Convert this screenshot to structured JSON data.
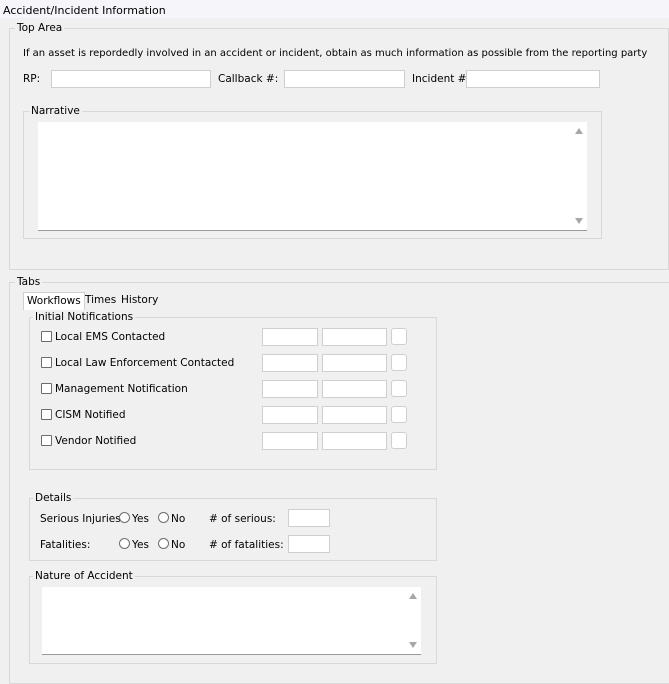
{
  "window": {
    "title": "Accident/Incident Information"
  },
  "top_area": {
    "legend": "Top Area",
    "instructions": "If an asset is repordedly involved in an accident or incident, obtain as much information as possible from the reporting party",
    "rp_label": "RP:",
    "rp_value": "",
    "callback_label": "Callback #:",
    "callback_value": "",
    "incident_label": "Incident #",
    "incident_value": "",
    "narrative_legend": "Narrative",
    "narrative_value": ""
  },
  "tabs_group": {
    "legend": "Tabs",
    "tabs": [
      {
        "label": "Workflows",
        "active": true
      },
      {
        "label": "Times",
        "active": false
      },
      {
        "label": "History",
        "active": false
      }
    ]
  },
  "initial_notifications": {
    "legend": "Initial Notifications",
    "items": [
      {
        "label": "Local EMS Contacted",
        "checked": false
      },
      {
        "label": "Local Law Enforcement Contacted",
        "checked": false
      },
      {
        "label": "Management Notification",
        "checked": false
      },
      {
        "label": "CISM Notified",
        "checked": false
      },
      {
        "label": "Vendor Notified",
        "checked": false
      }
    ]
  },
  "details": {
    "legend": "Details",
    "serious_injuries_label": "Serious Injuries:",
    "fatalities_label": "Fatalities:",
    "yes_label": "Yes",
    "no_label": "No",
    "num_serious_label": "# of serious:",
    "num_fatalities_label": "# of fatalities:",
    "num_serious_value": "",
    "num_fatalities_value": ""
  },
  "nature_of_accident": {
    "legend": "Nature of Accident",
    "value": ""
  }
}
